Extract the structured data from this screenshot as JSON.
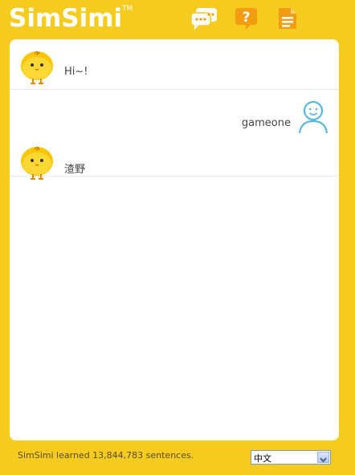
{
  "app": {
    "logo": "SimSimi",
    "trademark": "TM"
  },
  "toolbar": {
    "chat_icon": "chat-bubbles-icon",
    "help_icon": "question-bubble-icon",
    "notes_icon": "document-icon"
  },
  "messages": [
    {
      "sender": "bot",
      "avatar": "simsimi-chick-avatar",
      "text": "Hi~!"
    },
    {
      "sender": "user",
      "avatar": "user-person-avatar",
      "text": "gameone"
    },
    {
      "sender": "bot",
      "avatar": "simsimi-chick-avatar",
      "text": "渣野"
    }
  ],
  "footer": {
    "status": "SimSimi learned 13,844,783 sentences.",
    "language_selected": "中文"
  },
  "colors": {
    "background": "#f6cb1f",
    "panel": "#ffffff",
    "icon_orange": "#f39c12",
    "user_avatar_blue": "#5bb8dd"
  }
}
